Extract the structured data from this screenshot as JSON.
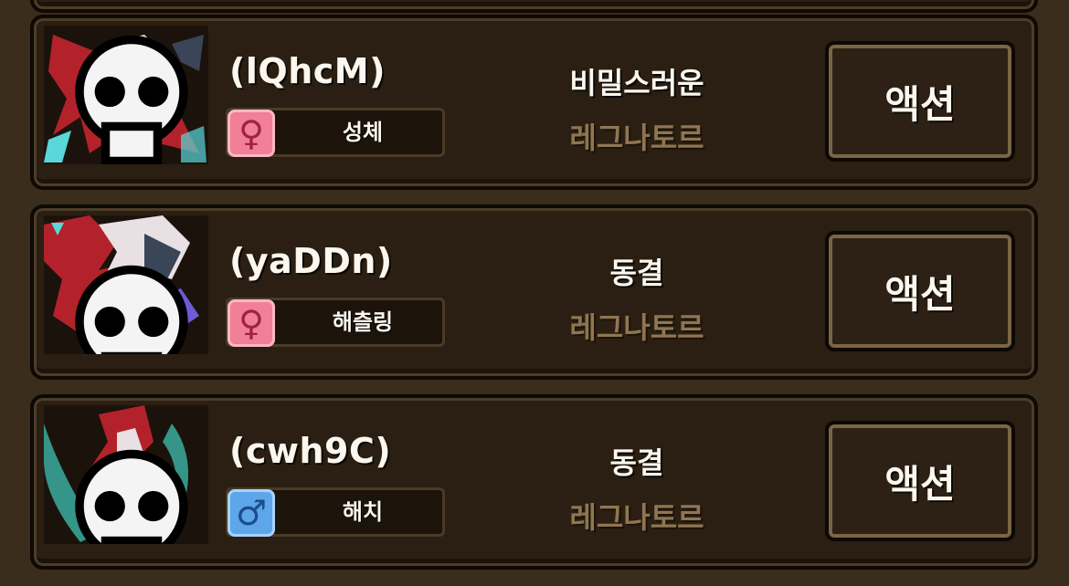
{
  "monsters": [
    {
      "name": "(lQhcM)",
      "gender": "female",
      "gender_symbol": "♀",
      "trait": "성체",
      "state": "비밀스러운",
      "species": "레그나토르",
      "action_label": "액션",
      "portrait_palette": [
        "#b3222b",
        "#e8e0e3",
        "#3a4558",
        "#58d8d8"
      ]
    },
    {
      "name": "(yaDDn)",
      "gender": "female",
      "gender_symbol": "♀",
      "trait": "해츨링",
      "state": "동결",
      "species": "레그나토르",
      "action_label": "액션",
      "portrait_palette": [
        "#b3222b",
        "#e8e0e3",
        "#3a4558",
        "#6f5bd8"
      ]
    },
    {
      "name": "(cwh9C)",
      "gender": "male",
      "gender_symbol": "♂",
      "trait": "해치",
      "state": "동결",
      "species": "레그나토르",
      "action_label": "액션",
      "portrait_palette": [
        "#b3222b",
        "#e8e0e3",
        "#1f2a2f",
        "#3bb6a8"
      ]
    }
  ],
  "colors": {
    "background": "#3b2d1b",
    "card": "#2a1f12",
    "species_text": "#8f7651",
    "female_badge": "#f07f97",
    "male_badge": "#5ea6ea"
  }
}
